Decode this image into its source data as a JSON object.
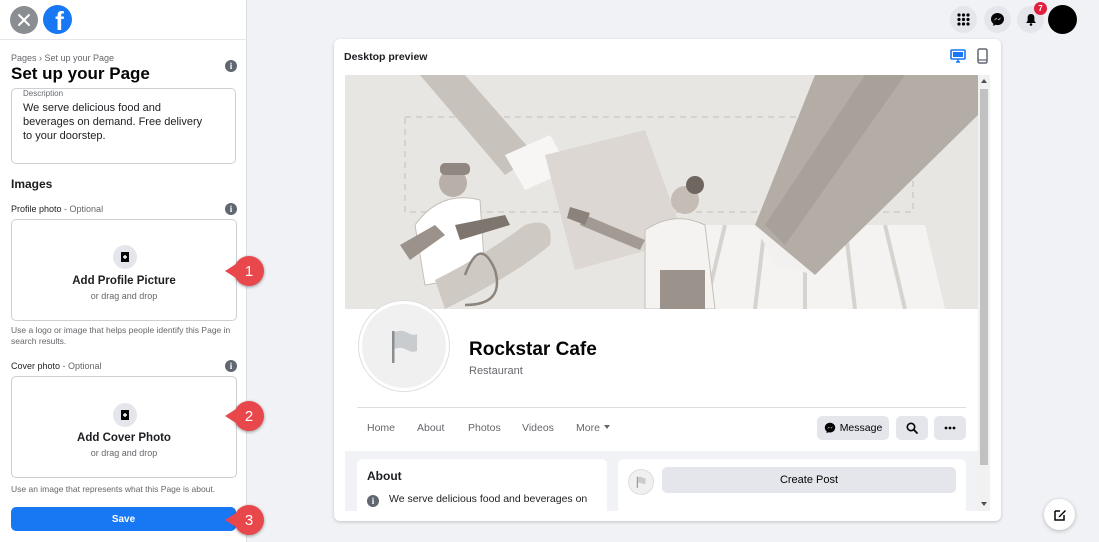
{
  "sidebar": {
    "breadcrumb": "Pages › Set up your Page",
    "title": "Set up your Page",
    "description": {
      "label": "Description",
      "value": "We serve delicious food and beverages on demand. Free delivery to your doorstep."
    },
    "images_heading": "Images",
    "profile_photo": {
      "label": "Profile photo",
      "optional": " - Optional",
      "upload_title": "Add Profile Picture",
      "upload_sub": "or drag and drop",
      "help": "Use a logo or image that helps people identify this Page in search results."
    },
    "cover_photo": {
      "label": "Cover photo",
      "optional": " - Optional",
      "upload_title": "Add Cover Photo",
      "upload_sub": "or drag and drop",
      "help": "Use an image that represents what this Page is about."
    },
    "save_label": "Save"
  },
  "callouts": [
    "1",
    "2",
    "3"
  ],
  "header": {
    "notification_count": "7",
    "icons": [
      "menu-grid-icon",
      "messenger-icon",
      "bell-icon"
    ]
  },
  "preview": {
    "title": "Desktop preview",
    "page_name": "Rockstar Cafe",
    "category": "Restaurant",
    "tabs": [
      "Home",
      "About",
      "Photos",
      "Videos",
      "More"
    ],
    "message_label": "Message",
    "about_title": "About",
    "about_text": "We serve delicious food and beverages on",
    "create_post_label": "Create Post"
  },
  "colors": {
    "accent": "#1877f2",
    "callout": "#e8474c",
    "badge": "#e41e3f"
  }
}
